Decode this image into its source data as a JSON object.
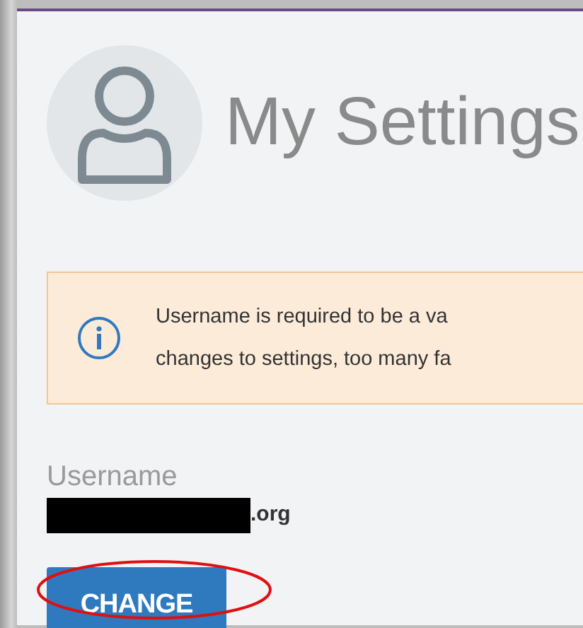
{
  "title": "My Settings",
  "alert": {
    "lines": [
      "Username is required to be a va",
      "changes to settings, too many fa"
    ]
  },
  "username": {
    "label": "Username",
    "value_visible": ".org",
    "redacted": true
  },
  "button": {
    "label": "CHANGE",
    "highlighted": true
  }
}
